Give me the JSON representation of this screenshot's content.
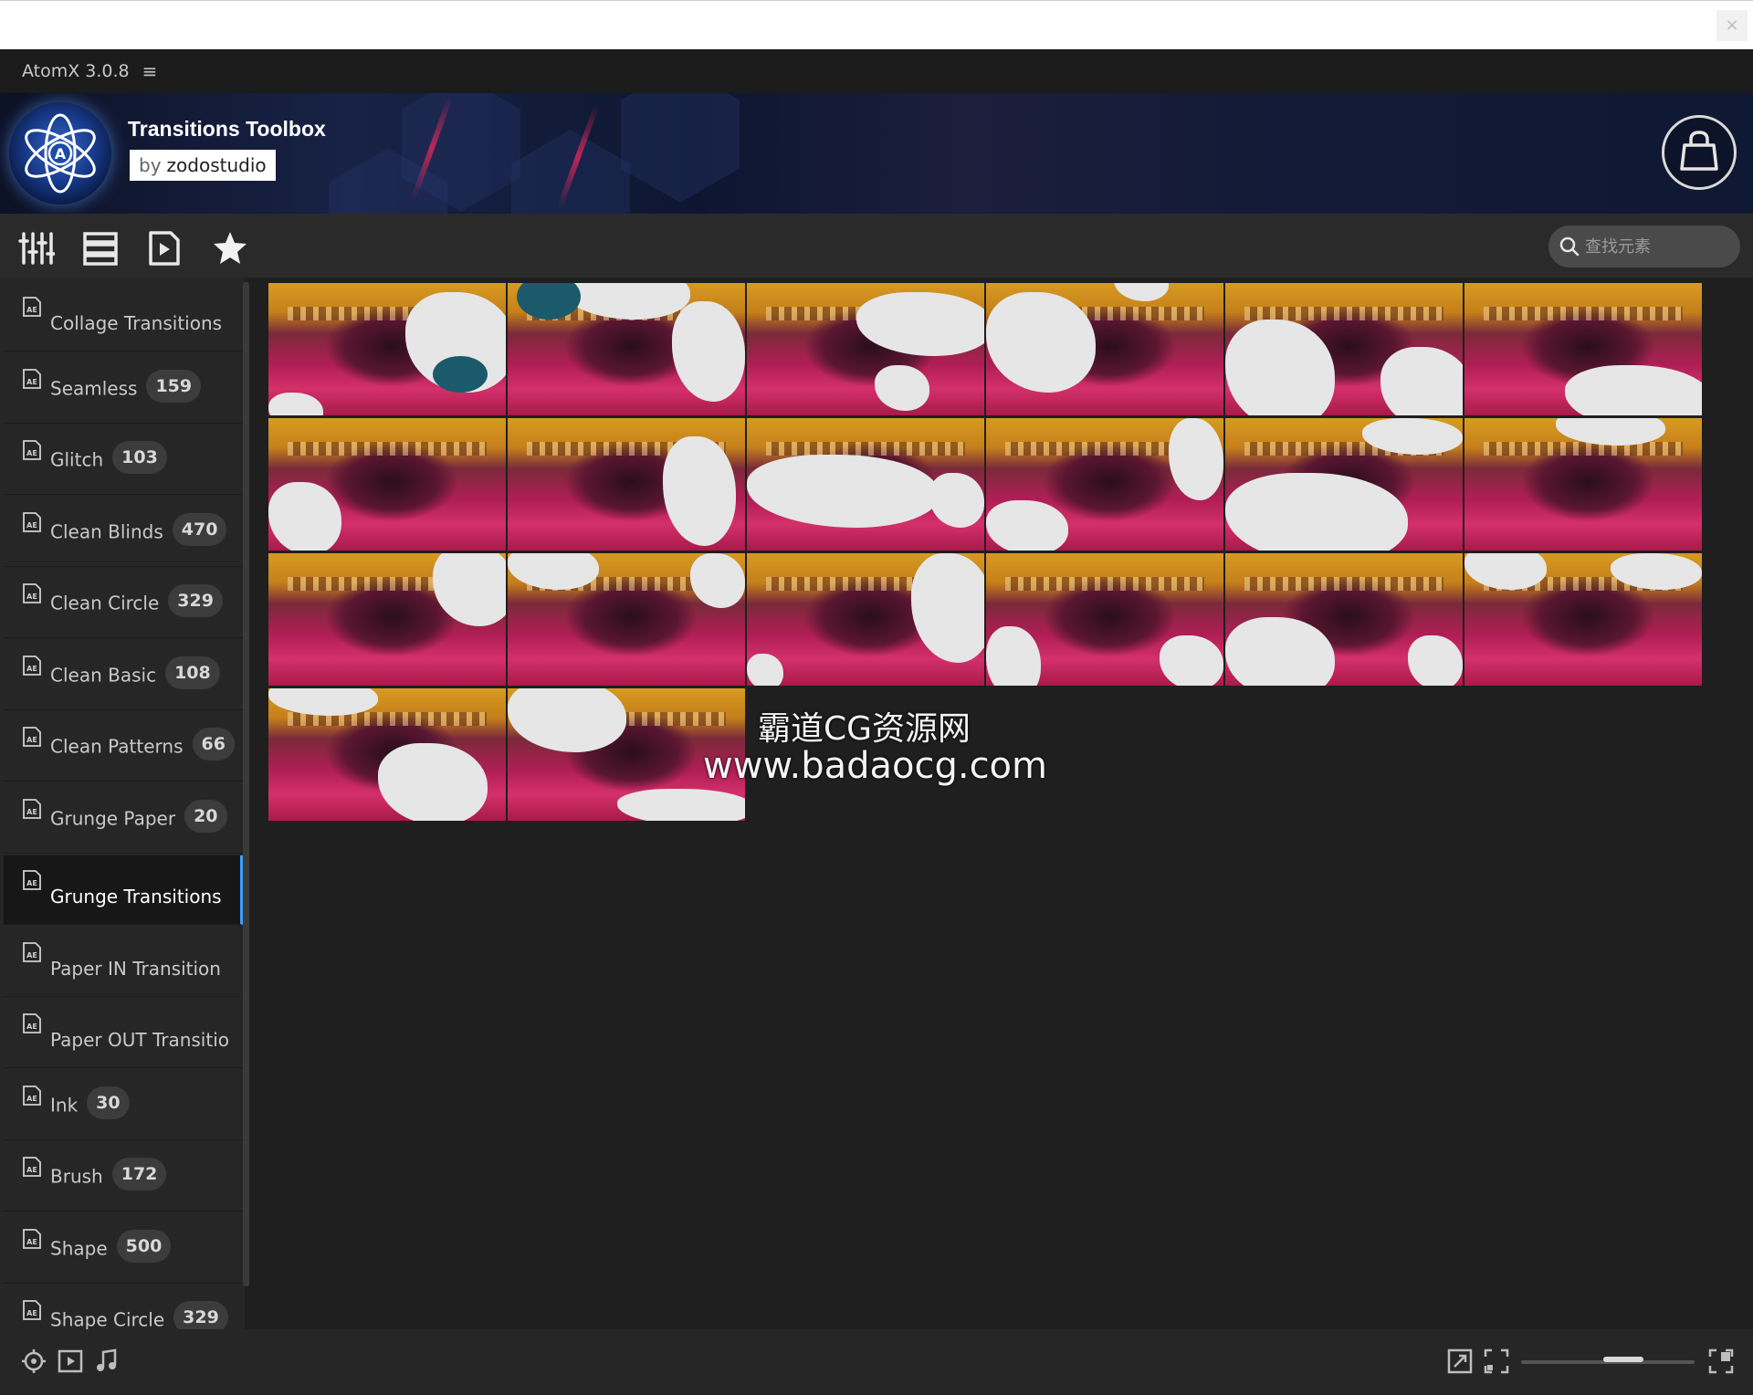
{
  "app": {
    "title": "AtomX 3.0.8",
    "close_glyph": "×"
  },
  "banner": {
    "title": "Transitions Toolbox",
    "by_prefix": "by",
    "author": "zodostudio"
  },
  "toolbar": {
    "icons": [
      "sliders-icon",
      "list-icon",
      "media-file-icon",
      "favorites-star-icon"
    ],
    "search_placeholder": "查找元素"
  },
  "sidebar": {
    "items": [
      {
        "label": "Collage Transitions",
        "count": ""
      },
      {
        "label": "Seamless",
        "count": "159"
      },
      {
        "label": "Glitch",
        "count": "103"
      },
      {
        "label": "Clean Blinds",
        "count": "470"
      },
      {
        "label": "Clean Circle",
        "count": "329"
      },
      {
        "label": "Clean Basic",
        "count": "108"
      },
      {
        "label": "Clean Patterns",
        "count": "66"
      },
      {
        "label": "Grunge Paper",
        "count": "20"
      },
      {
        "label": "Grunge Transitions",
        "count": "",
        "active": true
      },
      {
        "label": "Paper IN Transition",
        "count": ""
      },
      {
        "label": "Paper OUT Transitio",
        "count": ""
      },
      {
        "label": "Ink",
        "count": "30"
      },
      {
        "label": "Brush",
        "count": "172"
      },
      {
        "label": "Shape",
        "count": "500"
      },
      {
        "label": "Shape Circle",
        "count": "329"
      }
    ]
  },
  "grid": {
    "thumbnail_count": 20,
    "columns": 6
  },
  "watermark": {
    "line1": "霸道CG资源网",
    "line2": "www.badaocg.com"
  },
  "colors": {
    "accent": "#3aa0ff",
    "background": "#1f1f1f",
    "sidebar": "#262626"
  }
}
